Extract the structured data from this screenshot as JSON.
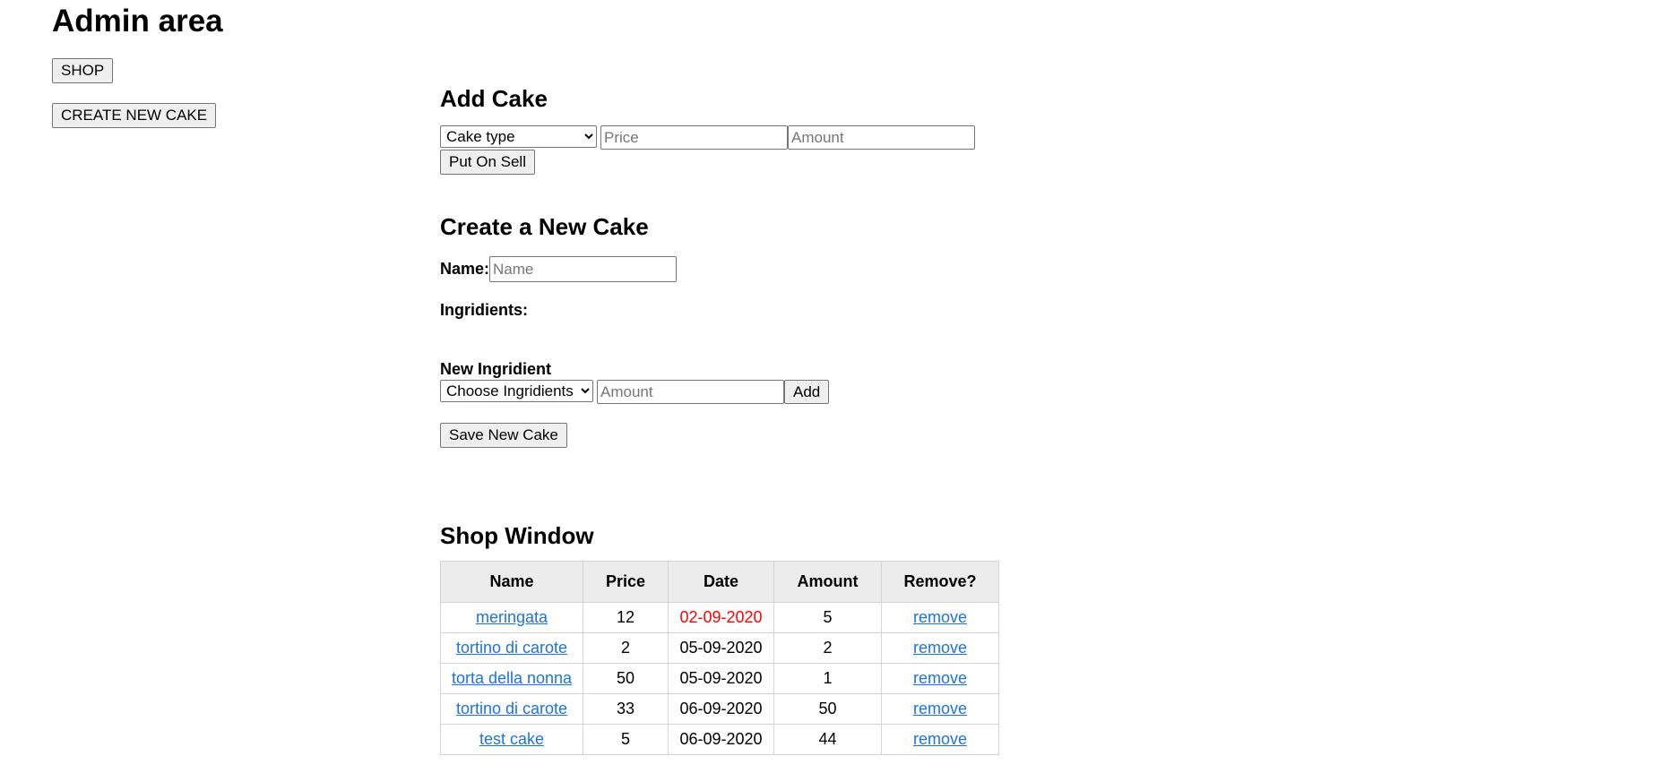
{
  "header": {
    "title": "Admin area"
  },
  "nav": {
    "shop_label": "SHOP",
    "create_new_cake_label": "CREATE NEW CAKE"
  },
  "add_cake": {
    "heading": "Add Cake",
    "cake_type_selected": "Cake type",
    "price_placeholder": "Price",
    "amount_placeholder": "Amount",
    "submit_label": "Put On Sell"
  },
  "create_cake": {
    "heading": "Create a New Cake",
    "name_label": "Name:",
    "name_placeholder": "Name",
    "ingredients_label": "Ingridients:",
    "new_ingredient_label": "New Ingridient",
    "ingredient_selected": "Choose Ingridients",
    "ingredient_amount_placeholder": "Amount",
    "add_label": "Add",
    "save_label": "Save New Cake"
  },
  "shop_window": {
    "heading": "Shop Window",
    "columns": [
      "Name",
      "Price",
      "Date",
      "Amount",
      "Remove?"
    ],
    "rows": [
      {
        "name": "meringata",
        "price": "12",
        "date": "02-09-2020",
        "amount": "5",
        "remove": "remove",
        "expired": true
      },
      {
        "name": "tortino di carote",
        "price": "2",
        "date": "05-09-2020",
        "amount": "2",
        "remove": "remove",
        "expired": false
      },
      {
        "name": "torta della nonna",
        "price": "50",
        "date": "05-09-2020",
        "amount": "1",
        "remove": "remove",
        "expired": false
      },
      {
        "name": "tortino di carote",
        "price": "33",
        "date": "06-09-2020",
        "amount": "50",
        "remove": "remove",
        "expired": false
      },
      {
        "name": "test cake",
        "price": "5",
        "date": "06-09-2020",
        "amount": "44",
        "remove": "remove",
        "expired": false
      }
    ]
  },
  "colors": {
    "link": "#1a73e8",
    "expired_date": "#ff0000",
    "table_header_bg": "#ececec"
  }
}
